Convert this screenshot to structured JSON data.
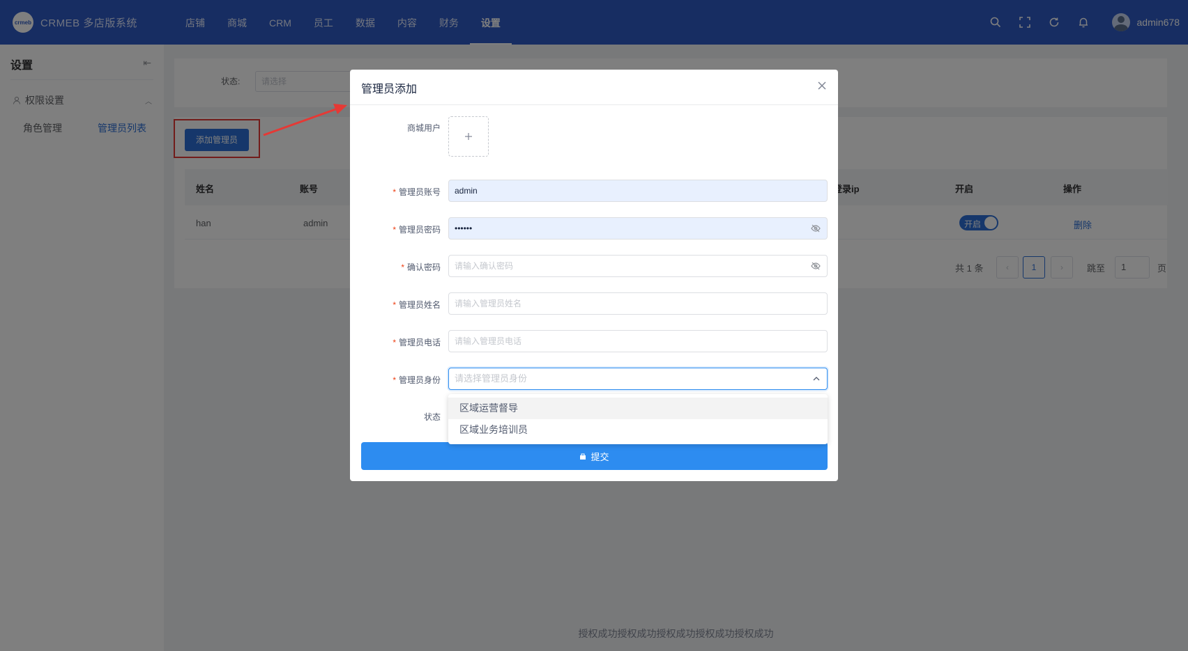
{
  "header": {
    "logo_mark": "crmeb",
    "logo_text": "CRMEB 多店版系统",
    "nav": [
      "店铺",
      "商城",
      "CRM",
      "员工",
      "数据",
      "内容",
      "财务",
      "设置"
    ],
    "active_nav": "设置",
    "username": "admin678"
  },
  "sidebar": {
    "title": "设置",
    "collapse_icon": "⇤",
    "group": "权限设置",
    "items": [
      "角色管理",
      "管理员列表"
    ],
    "active_item": "管理员列表"
  },
  "filter": {
    "status_label": "状态:",
    "status_placeholder": "请选择"
  },
  "add_button": "添加管理员",
  "table": {
    "headers": [
      "姓名",
      "账号",
      "登录ip",
      "开启",
      "操作"
    ],
    "rows": [
      {
        "name": "han",
        "account": "admin",
        "switch": "开启",
        "action": "删除"
      }
    ]
  },
  "pager": {
    "total": "共 1 条",
    "current": "1",
    "goto_label": "跳至",
    "goto_value": "1",
    "page_suffix": "页"
  },
  "modal": {
    "title": "管理员添加",
    "fields": {
      "user_label": "商城用户",
      "account_label": "管理员账号",
      "account_value": "admin",
      "password_label": "管理员密码",
      "password_value": "••••••",
      "confirm_label": "确认密码",
      "confirm_placeholder": "请输入确认密码",
      "name_label": "管理员姓名",
      "name_placeholder": "请输入管理员姓名",
      "phone_label": "管理员电话",
      "phone_placeholder": "请输入管理员电话",
      "role_label": "管理员身份",
      "role_placeholder": "请选择管理员身份",
      "status_label": "状态"
    },
    "role_options": [
      "区域运营督导",
      "区域业务培训员"
    ],
    "submit_label": "提交"
  },
  "footer_text": "授权成功授权成功授权成功授权成功授权成功",
  "colors": {
    "header": "#2f5bc4",
    "primary": "#2d8cf0",
    "highlight_box": "#e53935"
  }
}
